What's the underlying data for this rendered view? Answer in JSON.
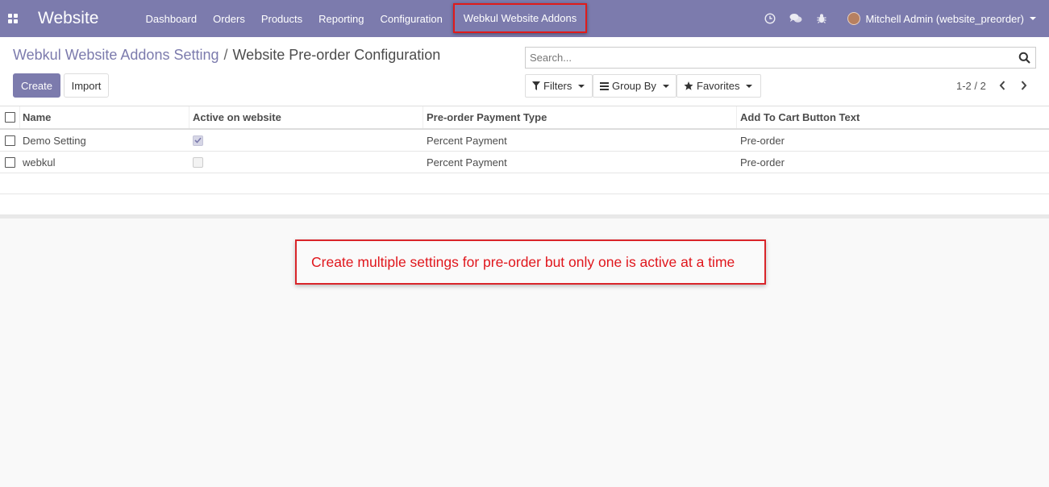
{
  "navbar": {
    "brand": "Website",
    "menu": [
      "Dashboard",
      "Orders",
      "Products",
      "Reporting",
      "Configuration"
    ],
    "highlighted_menu": "Webkul Website Addons",
    "user": "Mitchell Admin (website_preorder)",
    "icons": [
      "apps-grid-icon",
      "clock-icon",
      "chat-icon",
      "bug-icon",
      "user-avatar"
    ]
  },
  "control_panel": {
    "breadcrumb_parent": "Webkul Website Addons Setting",
    "breadcrumb_separator": "/",
    "breadcrumb_current": "Website Pre-order Configuration",
    "create_label": "Create",
    "import_label": "Import",
    "search_placeholder": "Search...",
    "filters_label": "Filters",
    "group_by_label": "Group By",
    "favorites_label": "Favorites",
    "pager": "1-2 / 2"
  },
  "list": {
    "columns": [
      "Name",
      "Active on website",
      "Pre-order Payment Type",
      "Add To Cart Button Text"
    ],
    "rows": [
      {
        "name": "Demo Setting",
        "active": true,
        "payment_type": "Percent Payment",
        "button_text": "Pre-order"
      },
      {
        "name": "webkul",
        "active": false,
        "payment_type": "Percent Payment",
        "button_text": "Pre-order"
      }
    ]
  },
  "annotation": {
    "text": "Create multiple settings for pre-order but only one is active at a time"
  },
  "colors": {
    "brand": "#7c7bad",
    "annotation_red": "#e0161c"
  }
}
